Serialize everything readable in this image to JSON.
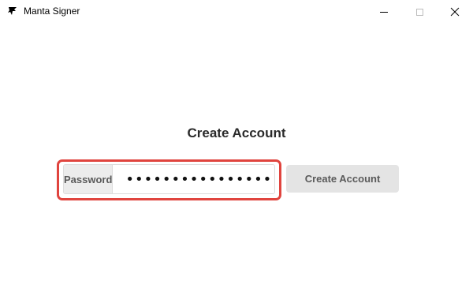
{
  "window": {
    "title": "Manta Signer",
    "app_icon": "manta-icon",
    "controls": {
      "minimize_icon": "minimize-icon",
      "maximize_icon": "maximize-icon",
      "close_icon": "close-icon",
      "close_glyph": "✕"
    }
  },
  "main": {
    "heading": "Create Account",
    "password": {
      "label": "Password",
      "value": "••••••••••••••••",
      "type": "password"
    },
    "create_button_label": "Create Account"
  },
  "colors": {
    "highlight_border": "#e0443e",
    "button_bg": "#e4e4e4",
    "label_bg": "#ececec"
  }
}
